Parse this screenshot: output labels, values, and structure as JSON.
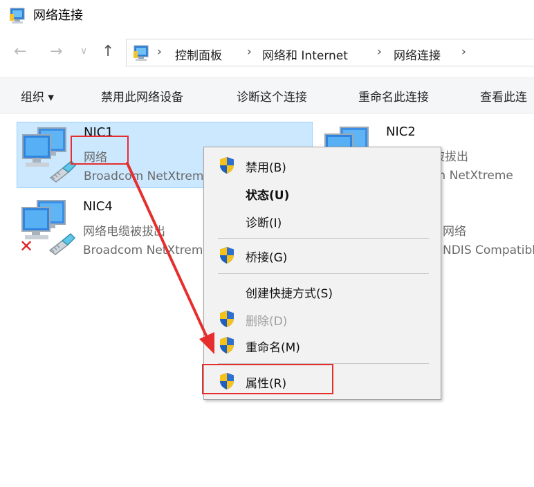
{
  "window": {
    "title": "网络连接",
    "icon": "network-connections-icon"
  },
  "nav": {
    "back_icon": "back-arrow-icon",
    "forward_icon": "forward-arrow-icon",
    "recent_icon": "chevron-down-icon",
    "up_icon": "up-arrow-icon"
  },
  "address": {
    "icon": "control-panel-icon",
    "separator": "›",
    "segments": [
      "控制面板",
      "网络和 Internet",
      "网络连接"
    ]
  },
  "toolbar": {
    "organize": "组织 ▾",
    "disable": "禁用此网络设备",
    "diagnose": "诊断这个连接",
    "rename": "重命名此连接",
    "view_status": "查看此连"
  },
  "adapters": [
    {
      "name": "NIC1",
      "status": "网络",
      "device": "Broadcom NetXtreme",
      "selected": true,
      "error": false
    },
    {
      "name": "NIC2",
      "status": "网络电缆被拔出",
      "device": "Broadcom NetXtreme",
      "selected": false,
      "error": false
    },
    {
      "name": "NIC4",
      "status": "网络电缆被拔出",
      "device": "Broadcom NetXtreme",
      "selected": false,
      "error": true
    },
    {
      "name": "",
      "status": "网络",
      "device": "NDIS Compatible",
      "selected": false,
      "error": false
    }
  ],
  "context_menu": {
    "items": [
      {
        "label": "禁用(B)",
        "shield": true,
        "bold": false,
        "disabled": false
      },
      {
        "label": "状态(U)",
        "shield": false,
        "bold": true,
        "disabled": false
      },
      {
        "label": "诊断(I)",
        "shield": false,
        "bold": false,
        "disabled": false
      },
      {
        "label": "桥接(G)",
        "shield": true,
        "bold": false,
        "disabled": false
      },
      {
        "label": "创建快捷方式(S)",
        "shield": false,
        "bold": false,
        "disabled": false
      },
      {
        "label": "删除(D)",
        "shield": true,
        "bold": false,
        "disabled": true
      },
      {
        "label": "重命名(M)",
        "shield": true,
        "bold": false,
        "disabled": false
      },
      {
        "label": "属性(R)",
        "shield": true,
        "bold": false,
        "disabled": false
      }
    ]
  },
  "colors": {
    "selection_bg": "#cce8ff",
    "annotation_red": "#e62e2e",
    "shield_blue": "#1f5fbf",
    "shield_yellow": "#f6c21a"
  }
}
